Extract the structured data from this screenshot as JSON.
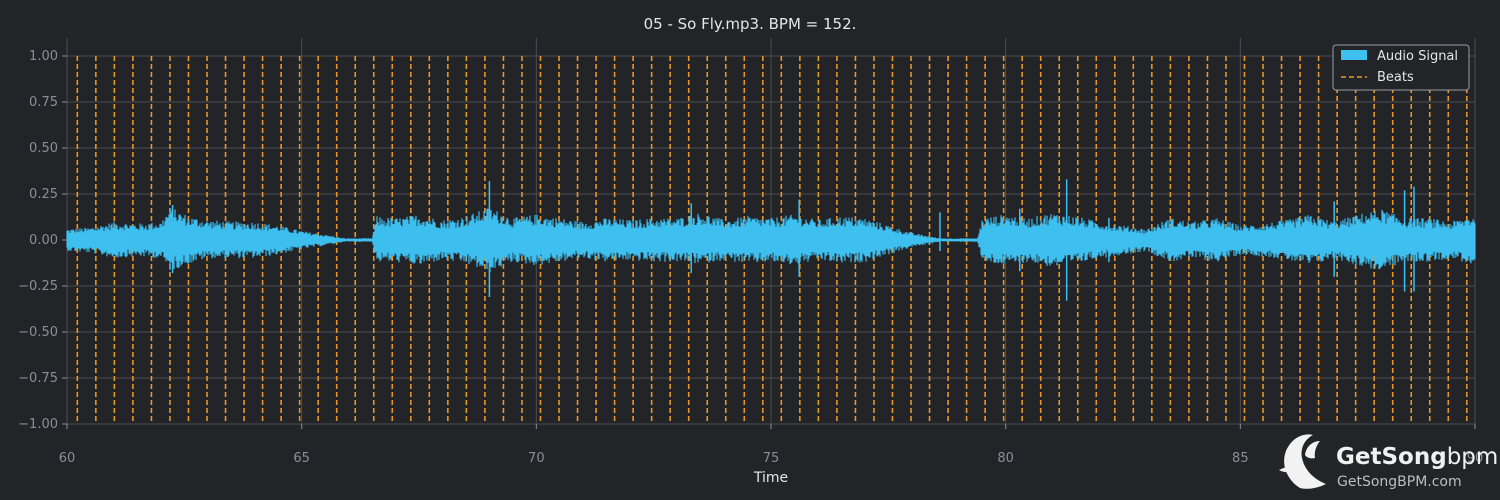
{
  "chart_data": {
    "type": "line",
    "title": "05 - So Fly.mp3. BPM = 152.",
    "xlabel": "Time",
    "ylabel": "",
    "xlim": [
      60,
      90
    ],
    "ylim": [
      -1.0,
      1.0
    ],
    "xticks": [
      60,
      65,
      70,
      75,
      80,
      85,
      90
    ],
    "yticks": [
      1.0,
      0.75,
      0.5,
      0.25,
      0.0,
      -0.25,
      -0.5,
      -0.75,
      -1.0
    ],
    "ytick_labels": [
      "1.00",
      "0.75",
      "0.50",
      "0.25",
      "0.00",
      "−0.25",
      "−0.50",
      "−0.75",
      "−1.00"
    ],
    "xtick_labels": [
      "60",
      "65",
      "70",
      "75",
      "80",
      "85",
      "90"
    ],
    "grid": true,
    "legend_position": "top-right",
    "bpm": 152,
    "first_beat": 60.22,
    "series": [
      {
        "name": "Audio Signal",
        "kind": "waveform-envelope",
        "color": "#3dbfef",
        "envelope": [
          [
            60.0,
            0.06,
            -0.06
          ],
          [
            60.5,
            0.07,
            -0.07
          ],
          [
            61.0,
            0.1,
            -0.1
          ],
          [
            61.5,
            0.09,
            -0.09
          ],
          [
            62.0,
            0.1,
            -0.1
          ],
          [
            62.2,
            0.18,
            -0.17
          ],
          [
            62.6,
            0.13,
            -0.13
          ],
          [
            63.0,
            0.11,
            -0.1
          ],
          [
            63.5,
            0.1,
            -0.1
          ],
          [
            64.0,
            0.1,
            -0.1
          ],
          [
            64.5,
            0.08,
            -0.08
          ],
          [
            65.0,
            0.05,
            -0.05
          ],
          [
            65.5,
            0.03,
            -0.03
          ],
          [
            65.9,
            0.01,
            -0.01
          ],
          [
            66.5,
            0.01,
            -0.01
          ],
          [
            66.6,
            0.13,
            -0.12
          ],
          [
            67.0,
            0.12,
            -0.12
          ],
          [
            67.5,
            0.14,
            -0.14
          ],
          [
            68.0,
            0.11,
            -0.11
          ],
          [
            68.5,
            0.13,
            -0.13
          ],
          [
            69.0,
            0.18,
            -0.18
          ],
          [
            69.5,
            0.12,
            -0.12
          ],
          [
            70.0,
            0.14,
            -0.14
          ],
          [
            70.5,
            0.12,
            -0.12
          ],
          [
            71.0,
            0.1,
            -0.1
          ],
          [
            71.5,
            0.12,
            -0.12
          ],
          [
            72.0,
            0.11,
            -0.11
          ],
          [
            72.5,
            0.12,
            -0.12
          ],
          [
            73.0,
            0.12,
            -0.12
          ],
          [
            73.5,
            0.15,
            -0.13
          ],
          [
            74.0,
            0.11,
            -0.11
          ],
          [
            74.5,
            0.13,
            -0.13
          ],
          [
            75.0,
            0.12,
            -0.12
          ],
          [
            75.5,
            0.14,
            -0.14
          ],
          [
            76.0,
            0.11,
            -0.11
          ],
          [
            76.5,
            0.13,
            -0.13
          ],
          [
            77.0,
            0.12,
            -0.12
          ],
          [
            77.5,
            0.08,
            -0.08
          ],
          [
            78.0,
            0.04,
            -0.04
          ],
          [
            78.6,
            0.01,
            -0.01
          ],
          [
            79.4,
            0.01,
            -0.01
          ],
          [
            79.5,
            0.12,
            -0.12
          ],
          [
            80.0,
            0.14,
            -0.14
          ],
          [
            80.5,
            0.12,
            -0.12
          ],
          [
            81.0,
            0.15,
            -0.15
          ],
          [
            81.5,
            0.13,
            -0.13
          ],
          [
            82.0,
            0.1,
            -0.1
          ],
          [
            82.5,
            0.08,
            -0.08
          ],
          [
            83.0,
            0.06,
            -0.06
          ],
          [
            83.5,
            0.12,
            -0.12
          ],
          [
            84.0,
            0.1,
            -0.1
          ],
          [
            84.5,
            0.12,
            -0.12
          ],
          [
            85.0,
            0.08,
            -0.08
          ],
          [
            85.5,
            0.09,
            -0.09
          ],
          [
            86.0,
            0.11,
            -0.11
          ],
          [
            86.5,
            0.14,
            -0.14
          ],
          [
            87.0,
            0.1,
            -0.1
          ],
          [
            87.5,
            0.14,
            -0.14
          ],
          [
            88.0,
            0.17,
            -0.17
          ],
          [
            88.5,
            0.12,
            -0.12
          ],
          [
            89.0,
            0.12,
            -0.12
          ],
          [
            89.5,
            0.1,
            -0.1
          ],
          [
            90.0,
            0.14,
            -0.14
          ]
        ],
        "spikes": [
          [
            62.25,
            0.19,
            -0.18
          ],
          [
            69.0,
            0.32,
            -0.31
          ],
          [
            73.3,
            0.2,
            -0.18
          ],
          [
            75.6,
            0.22,
            -0.2
          ],
          [
            78.6,
            0.15,
            -0.06
          ],
          [
            80.3,
            0.17,
            -0.17
          ],
          [
            81.3,
            0.33,
            -0.33
          ],
          [
            82.2,
            0.12,
            -0.12
          ],
          [
            87.0,
            0.21,
            -0.2
          ],
          [
            88.5,
            0.27,
            -0.28
          ],
          [
            88.7,
            0.29,
            -0.28
          ]
        ]
      },
      {
        "name": "Beats",
        "kind": "vertical-dashed-lines",
        "color": "#e8962a"
      }
    ]
  },
  "legend": {
    "items": [
      {
        "label": "Audio Signal",
        "swatch": "patch",
        "color": "#3dbfef"
      },
      {
        "label": "Beats",
        "swatch": "dashed",
        "color": "#e8962a"
      }
    ]
  },
  "watermark": {
    "brand": "GetSong",
    "brand_accent": "bpm",
    "url": "GetSongBPM.com"
  },
  "colors": {
    "background": "#232428",
    "grid": "#4a4d53",
    "text": "#e6e6e6",
    "tick": "#8a8f97"
  }
}
